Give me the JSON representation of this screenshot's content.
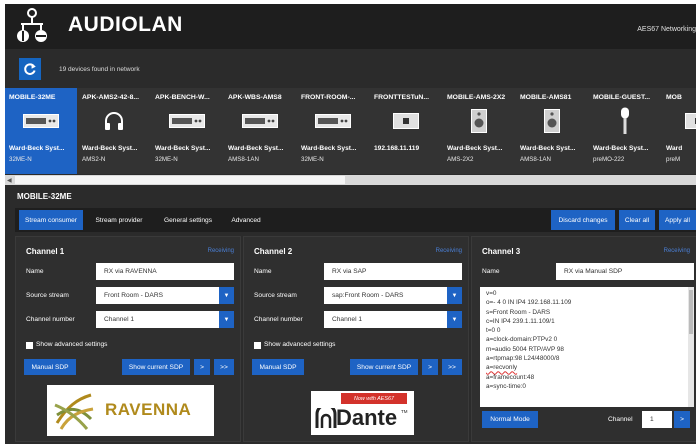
{
  "header": {
    "app_name": "AUDIOLAN",
    "right_label": "AES67 Networking"
  },
  "devices_bar": {
    "count_text": "19 devices found in network"
  },
  "devices": [
    {
      "title": "MOBILE-32ME",
      "vendor": "Ward-Beck Syst...",
      "model": "32ME-N",
      "icon": "rack-unit-icon",
      "selected": true
    },
    {
      "title": "APK-AMS2-42-8...",
      "vendor": "Ward-Beck Syst...",
      "model": "AMS2-N",
      "icon": "headphones-icon",
      "selected": false
    },
    {
      "title": "APK-BENCH-W...",
      "vendor": "Ward-Beck Syst...",
      "model": "32ME-N",
      "icon": "rack-unit-icon",
      "selected": false
    },
    {
      "title": "APK-WBS-AMS8",
      "vendor": "Ward-Beck Syst...",
      "model": "AMS8-1AN",
      "icon": "rack-unit-icon",
      "selected": false
    },
    {
      "title": "FRONT-ROOM-...",
      "vendor": "Ward-Beck Syst...",
      "model": "32ME-N",
      "icon": "rack-unit-icon",
      "selected": false
    },
    {
      "title": "FRONTTESTuN...",
      "vendor": "192.168.11.119",
      "model": "",
      "icon": "box-icon",
      "selected": false
    },
    {
      "title": "MOBILE-AMS-2X2",
      "vendor": "Ward-Beck Syst...",
      "model": "AMS-2X2",
      "icon": "speaker-icon",
      "selected": false
    },
    {
      "title": "MOBILE-AMS81",
      "vendor": "Ward-Beck Syst...",
      "model": "AMS8-1AN",
      "icon": "speaker-icon",
      "selected": false
    },
    {
      "title": "MOBILE-GUEST...",
      "vendor": "Ward-Beck Syst...",
      "model": "preMO-222",
      "icon": "microphone-icon",
      "selected": false
    },
    {
      "title": "MOB",
      "vendor": "Ward",
      "model": "preM",
      "icon": "box-icon",
      "selected": false
    }
  ],
  "device_heading": "MOBILE-32ME",
  "tabs": [
    {
      "label": "Stream consumer",
      "active": true
    },
    {
      "label": "Stream provider",
      "active": false
    },
    {
      "label": "General settings",
      "active": false
    },
    {
      "label": "Advanced",
      "active": false
    }
  ],
  "actions": {
    "discard": "Discard changes",
    "clear": "Clear all",
    "apply": "Apply all"
  },
  "channels": [
    {
      "title": "Channel 1",
      "status": "Receiving",
      "name_label": "Name",
      "name_value": "RX via RAVENNA",
      "source_label": "Source stream",
      "source_value": "Front Room - DARS",
      "number_label": "Channel number",
      "number_value": "Channel 1",
      "advanced_label": "Show advanced settings",
      "manual_sdp": "Manual SDP",
      "show_sdp": "Show current SDP",
      "next": ">",
      "last": ">>"
    },
    {
      "title": "Channel 2",
      "status": "Receiving",
      "name_label": "Name",
      "name_value": "RX via SAP",
      "source_label": "Source stream",
      "source_value": "sap:Front Room - DARS",
      "number_label": "Channel number",
      "number_value": "Channel 1",
      "advanced_label": "Show advanced settings",
      "manual_sdp": "Manual SDP",
      "show_sdp": "Show current SDP",
      "next": ">",
      "last": ">>"
    },
    {
      "title": "Channel 3",
      "status": "Receiving",
      "name_label": "Name",
      "name_value": "RX via Manual SDP",
      "sdp_lines": [
        "v=0",
        "o=- 4 0 IN IP4 192.168.11.109",
        "s=Front Room - DARS",
        "c=IN IP4 239.1.11.109/1",
        "t=0 0",
        "a=clock-domain:PTPv2 0",
        "m=audio 5004 RTP/AVP 98",
        "a=rtpmap:98 L24/48000/8",
        "a=recvonly",
        "a=framecount:48",
        "a=sync-time:0"
      ],
      "normal_mode": "Normal Mode",
      "channel_label": "Channel",
      "channel_value": "1",
      "next": ">"
    }
  ],
  "logos": {
    "ravenna": "RAVENNA",
    "dante_badge": "Now with AES67",
    "dante": "Dante",
    "dante_tm": "TM"
  },
  "colors": {
    "accent": "#1e63c4",
    "background": "#2b2b2b",
    "header": "#1e1e1e",
    "status_link": "#4a7fd6",
    "ravenna_gold": "#b08a1c",
    "dante_red": "#d3322b"
  }
}
